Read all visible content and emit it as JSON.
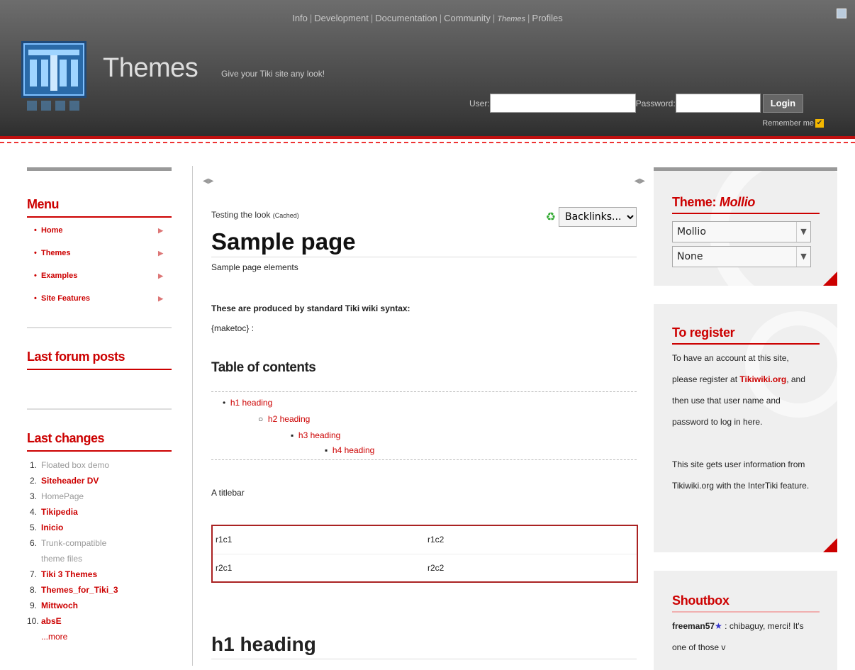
{
  "header": {
    "nav": [
      "Info",
      "Development",
      "Documentation",
      "Community",
      "Themes",
      "Profiles"
    ],
    "site_title": "Themes",
    "slogan": "Give your Tiki site any look!",
    "user_label": "User:",
    "password_label": "Password:",
    "login_button": "Login",
    "remember_label": "Remember me",
    "remember_checked": true
  },
  "left": {
    "menu_title": "Menu",
    "menu_items": [
      {
        "label": "Home"
      },
      {
        "label": "Themes"
      },
      {
        "label": "Examples"
      },
      {
        "label": "Site Features"
      }
    ],
    "forum_title": "Last forum posts",
    "changes_title": "Last changes",
    "changes": [
      {
        "n": "1.",
        "label": "Floated box demo",
        "style": "g"
      },
      {
        "n": "2.",
        "label": "Siteheader DV",
        "style": "r"
      },
      {
        "n": "3.",
        "label": "HomePage",
        "style": "g"
      },
      {
        "n": "4.",
        "label": "Tikipedia",
        "style": "r"
      },
      {
        "n": "5.",
        "label": "Inicio",
        "style": "r"
      },
      {
        "n": "6.",
        "label": "Trunk-compatible",
        "label2": "theme files",
        "style": "g"
      },
      {
        "n": "7.",
        "label": "Tiki 3 Themes",
        "style": "r"
      },
      {
        "n": "8.",
        "label": "Themes_for_Tiki_3",
        "style": "r"
      },
      {
        "n": "9.",
        "label": "Mittwoch",
        "style": "r"
      },
      {
        "n": "10.",
        "label": "absE",
        "style": "r"
      }
    ],
    "more": "...more"
  },
  "center": {
    "crumb": "Testing the look",
    "cached": "(Cached)",
    "backlinks": "Backlinks...",
    "page_title": "Sample page",
    "description": "Sample page elements",
    "intro": "These are produced by standard Tiki wiki syntax:",
    "maketoc": "{maketoc} :",
    "toc_title": "Table of contents",
    "toc": [
      "h1 heading",
      "h2 heading",
      "h3 heading",
      "h4 heading"
    ],
    "titlebar": "A titlebar",
    "table": [
      [
        "r1c1",
        "r1c2"
      ],
      [
        "r2c1",
        "r2c2"
      ]
    ],
    "h1": "h1 heading"
  },
  "right": {
    "theme_label": "Theme:",
    "theme_name": "Mollio",
    "theme_select": "Mollio",
    "option_select": "None",
    "register_title": "To register",
    "register_text1": "To have an account at this site, please register at",
    "register_link": "Tikiwiki.org",
    "register_text2": ", and then use that user name and password to log in here.",
    "register_text3": "This site gets user information from Tikiwiki.org with the InterTiki feature.",
    "shoutbox_title": "Shoutbox",
    "shout_user": "freeman57",
    "shout_text": ": chibaguy, merci! It's one of those v"
  },
  "colors": {
    "accent": "#cc0000",
    "header_bg": "#4a4a4a",
    "box_bg": "#efefef"
  }
}
